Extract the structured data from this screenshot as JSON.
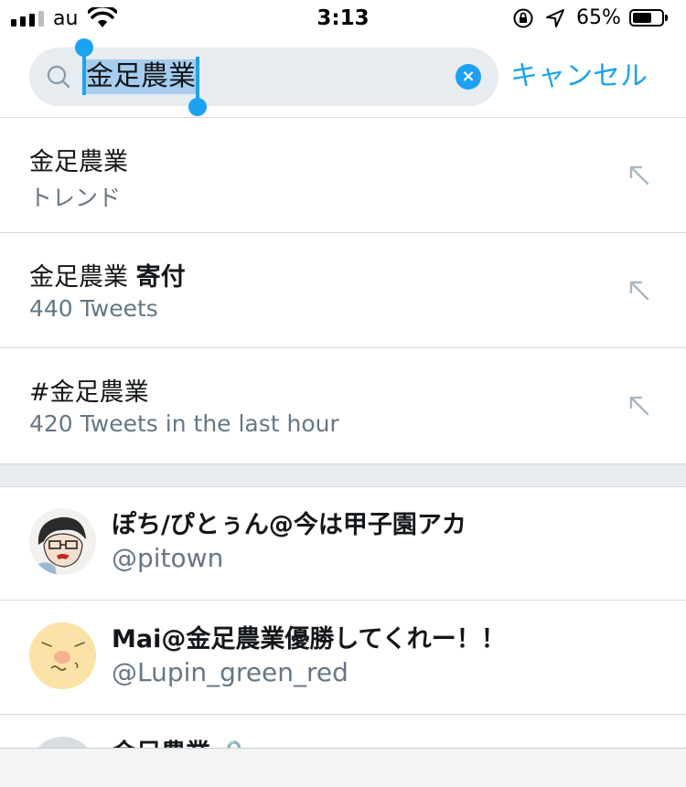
{
  "status_bar": {
    "carrier": "au",
    "time": "3:13",
    "battery_percent": "65%",
    "battery_level": 0.65
  },
  "search": {
    "query": "金足農業",
    "cancel_label": "キャンセル",
    "clear_icon": "×"
  },
  "suggestions": [
    {
      "title": "金足農業",
      "title_bold": "",
      "subtitle": "トレンド"
    },
    {
      "title": "金足農業 ",
      "title_bold": "寄付",
      "subtitle": "440 Tweets"
    },
    {
      "title": "#金足農業",
      "title_bold": "",
      "subtitle": "420 Tweets in the last hour"
    }
  ],
  "users": [
    {
      "name": "ぽち/ぴとぅん@今は甲子園アカ",
      "handle": "@pitown"
    },
    {
      "name": "Mai@金足農業優勝してくれー！！",
      "handle": "@Lupin_green_red"
    },
    {
      "name": "金足農業 🔒",
      "handle": ""
    }
  ],
  "colors": {
    "accent": "#1da1f2",
    "secondary_text": "#657786",
    "search_bg": "#e6ecf0"
  }
}
